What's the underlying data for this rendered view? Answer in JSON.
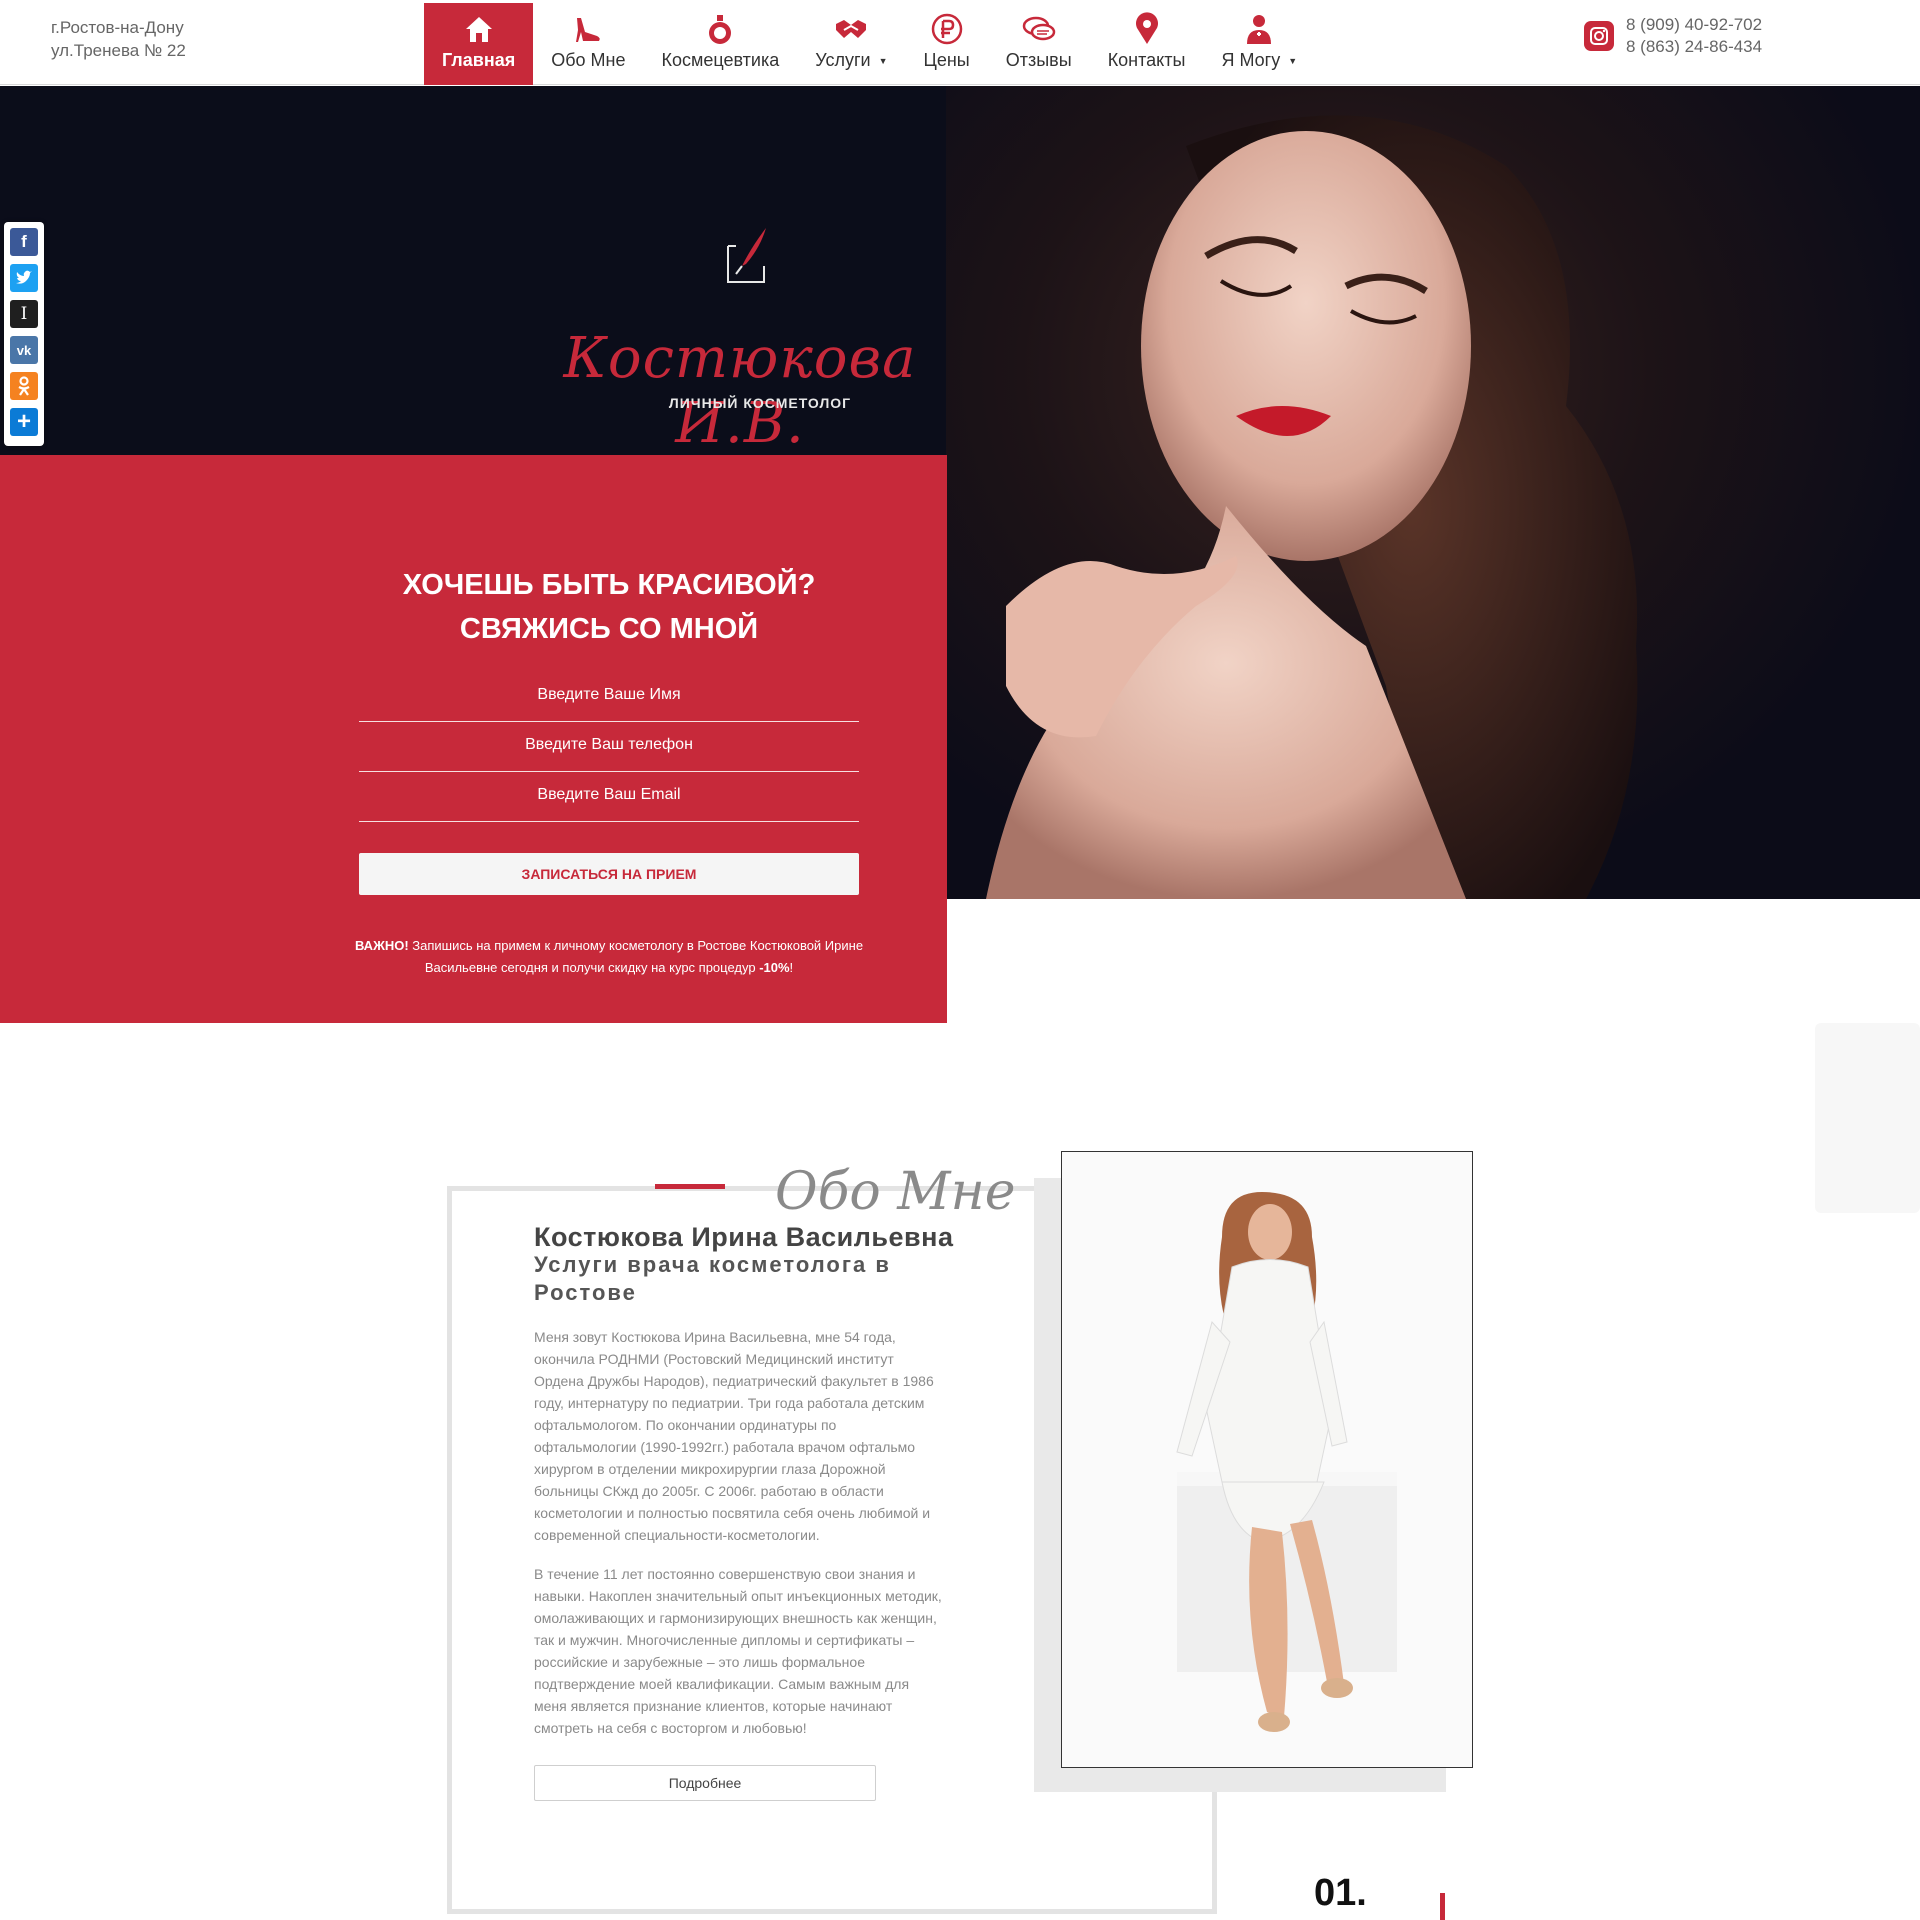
{
  "header": {
    "address_line1": "г.Ростов-на-Дону",
    "address_line2": "ул.Тренева № 22",
    "phone1": "8 (909) 40-92-702",
    "phone2": "8 (863) 24-86-434"
  },
  "nav": {
    "items": [
      {
        "label": "Главная",
        "icon": "home-icon"
      },
      {
        "label": "Обо Мне",
        "icon": "shoe-icon"
      },
      {
        "label": "Космецевтика",
        "icon": "perfume-icon"
      },
      {
        "label": "Услуги",
        "icon": "handshake-icon"
      },
      {
        "label": "Цены",
        "icon": "ruble-icon"
      },
      {
        "label": "Отзывы",
        "icon": "chat-icon"
      },
      {
        "label": "Контакты",
        "icon": "map-pin-icon"
      },
      {
        "label": "Я Могу",
        "icon": "doctor-icon"
      }
    ]
  },
  "hero": {
    "brand": "Костюкова И.В.",
    "brand_sub": "ЛИЧНЫЙ КОСМЕТОЛОГ"
  },
  "share": [
    "facebook-icon",
    "twitter-icon",
    "instapaper-icon",
    "vk-icon",
    "odnoklassniki-icon",
    "share-icon"
  ],
  "form": {
    "title_line1": "ХОЧЕШЬ БЫТЬ КРАСИВОЙ?",
    "title_line2": "СВЯЖИСЬ СО МНОЙ",
    "name_placeholder": "Введите Ваше Имя",
    "phone_placeholder": "Введите Ваш телефон",
    "email_placeholder": "Введите Ваш Email",
    "submit_label": "ЗАПИСАТЬСЯ НА ПРИЕМ",
    "notice_strong": "ВАЖНО!",
    "notice_text": " Запишись на примем к личному косметологу в Ростове Костюковой Ирине Васильевне сегодня и получи скидку на курс процедур ",
    "notice_discount": "-10%",
    "notice_end": "!"
  },
  "about": {
    "script_title": "Обо Мне",
    "name": "Костюкова Ирина Васильевна",
    "subtitle": "Услуги врача косметолога в Ростове",
    "paragraph1": "Меня зовут Костюкова Ирина Васильевна, мне 54 года, окончила РОДНМИ (Ростовский Медицинский институт Ордена Дружбы Народов), педиатрический факультет в 1986 году, интернатуру по педиатрии. Три года работала детским офтальмологом. По окончании ординатуры по офтальмологии (1990-1992гг.) работала врачом офтальмо хирургом в отделении микрохирургии глаза Дорожной больницы СКжд до 2005г. С 2006г. работаю в области косметологии и полностью посвятила себя очень любимой и современной специальности-косметологии.",
    "paragraph2": "В течение 11 лет постоянно совершенствую свои знания и навыки. Накоплен значительный опыт инъекционных методик, омолаживающих и гармонизирующих внешность как женщин, так и мужчин. Многочисленные дипломы и сертификаты – российские и зарубежные – это лишь формальное подтверждение моей квалификации. Самым важным для меня является признание клиентов, которые начинают смотреть на себя с восторгом и любовью!",
    "more_label": "Подробнее",
    "number": "01."
  },
  "colors": {
    "accent": "#c7293a",
    "hero_bg": "#0b0d1a"
  }
}
